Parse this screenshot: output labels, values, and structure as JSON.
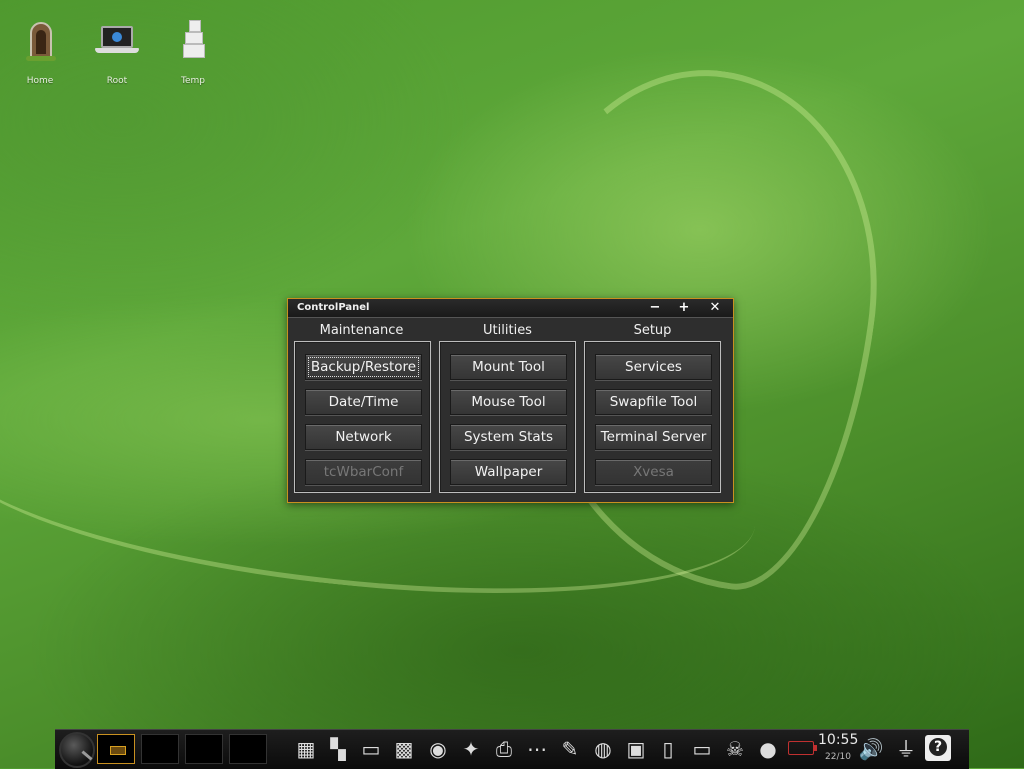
{
  "desktop": {
    "icons": [
      {
        "label": "Home",
        "icon": "door-icon"
      },
      {
        "label": "Root",
        "icon": "laptop-icon"
      },
      {
        "label": "Temp",
        "icon": "boxes-icon"
      }
    ]
  },
  "window": {
    "title": "ControlPanel",
    "controls": {
      "minimize": "−",
      "maximize": "+",
      "close": "✕"
    },
    "accent": "#c89020",
    "columns": [
      {
        "title": "Maintenance",
        "buttons": [
          {
            "label": "Backup/Restore",
            "enabled": true,
            "focused": true
          },
          {
            "label": "Date/Time",
            "enabled": true
          },
          {
            "label": "Network",
            "enabled": true
          },
          {
            "label": "tcWbarConf",
            "enabled": false
          }
        ]
      },
      {
        "title": "Utilities",
        "buttons": [
          {
            "label": "Mount Tool",
            "enabled": true
          },
          {
            "label": "Mouse Tool",
            "enabled": true
          },
          {
            "label": "System Stats",
            "enabled": true
          },
          {
            "label": "Wallpaper",
            "enabled": true
          }
        ]
      },
      {
        "title": "Setup",
        "buttons": [
          {
            "label": "Services",
            "enabled": true
          },
          {
            "label": "Swapfile Tool",
            "enabled": true
          },
          {
            "label": "Terminal Server",
            "enabled": true
          },
          {
            "label": "Xvesa",
            "enabled": false
          }
        ]
      }
    ]
  },
  "taskbar": {
    "clock": "10:55",
    "date": "22/10",
    "launchers": [
      "windows-grid-icon",
      "tiles-icon",
      "terminal-icon",
      "calculator-icon",
      "disk-install-icon",
      "wand-icon",
      "printer-icon",
      "dots-icon",
      "notepad-icon",
      "knob-icon",
      "photo-icon",
      "ipod-icon",
      "monitor-icon",
      "pirate-icon",
      "camera-icon"
    ],
    "tray": [
      "battery-icon",
      "volume-icon",
      "usb-icon",
      "help-icon"
    ]
  }
}
